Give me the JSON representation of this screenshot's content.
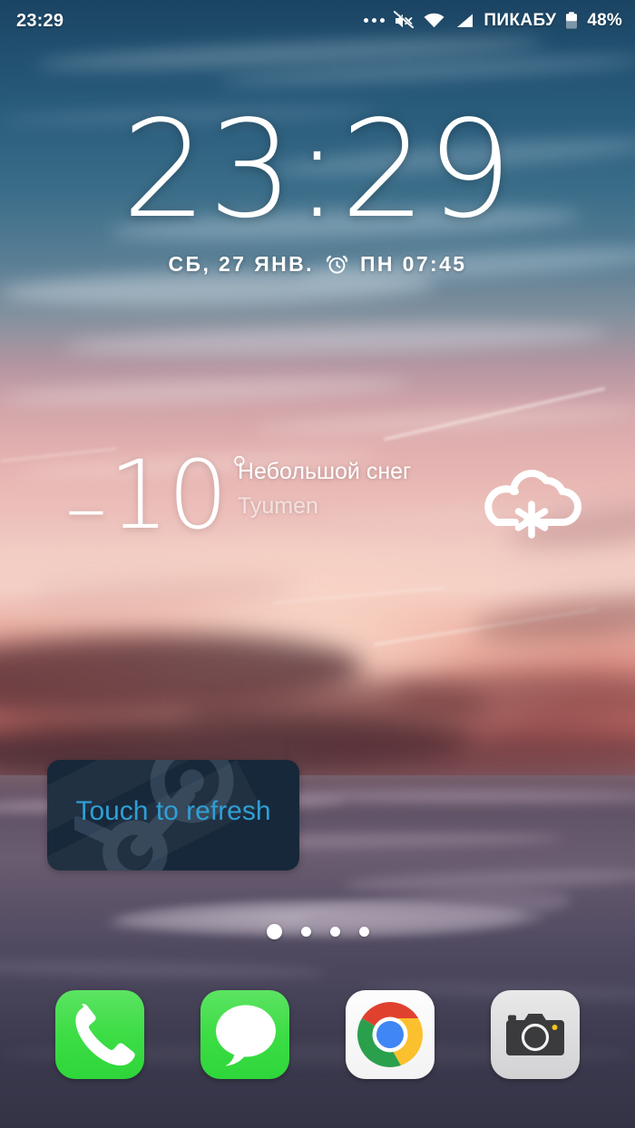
{
  "status_bar": {
    "clock": "23:29",
    "notification_dots_icon": "more-notifications-icon",
    "mute_icon": "volume-mute-icon",
    "wifi_icon": "wifi-icon",
    "signal_icon": "cellular-signal-icon",
    "carrier": "ПИКАБУ",
    "battery_icon": "battery-icon",
    "battery_percent": "48%"
  },
  "clock_widget": {
    "time": "23:29",
    "date": "СБ, 27 ЯНВ.",
    "alarm_icon": "alarm-clock-icon",
    "alarm_time": "ПН 07:45"
  },
  "weather_widget": {
    "minus_sign": "–",
    "temperature": "10",
    "degree": "°",
    "condition": "Небольшой снег",
    "city": "Tyumen",
    "icon": "cloud-snow-icon"
  },
  "steam_widget": {
    "label": "Touch to refresh",
    "logo_icon": "steam-logo-icon",
    "accent_color": "#2f9fd6",
    "background_color": "#17283a"
  },
  "page_indicator": {
    "total": 4,
    "active_index": 0
  },
  "dock": {
    "items": [
      {
        "name": "phone",
        "icon": "phone-icon",
        "color": "#3ddd45"
      },
      {
        "name": "messages",
        "icon": "message-bubble-icon",
        "color": "#3ddd45"
      },
      {
        "name": "chrome",
        "icon": "chrome-icon",
        "color": "#ffffff"
      },
      {
        "name": "camera",
        "icon": "camera-icon",
        "color": "#d8d8da"
      }
    ]
  }
}
